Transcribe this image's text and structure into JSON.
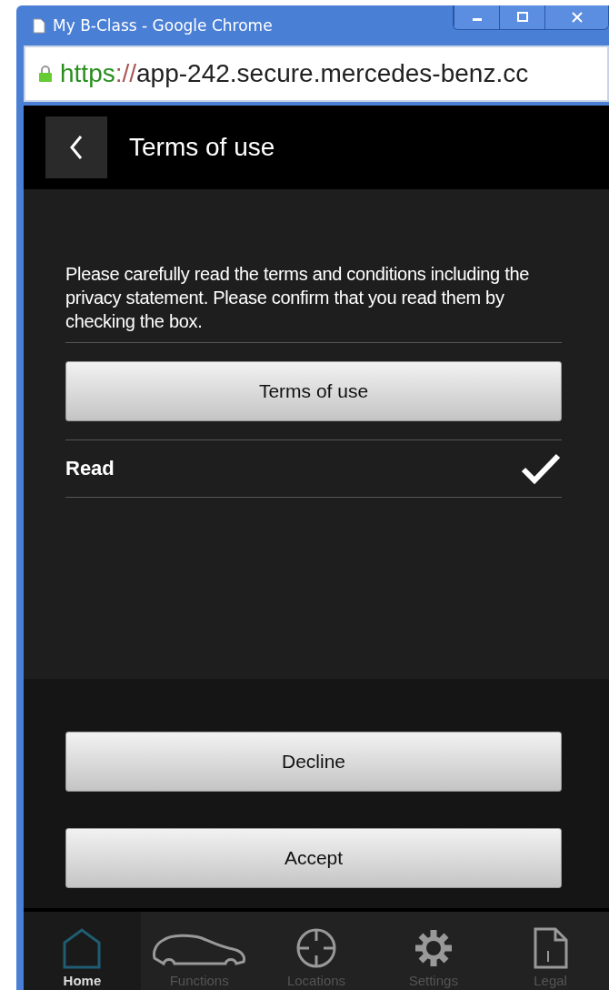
{
  "window": {
    "title": "My B-Class - Google Chrome"
  },
  "address_bar": {
    "scheme": "https",
    "separator": "://",
    "host": "app-242.secure.mercedes-benz.cc"
  },
  "header": {
    "title": "Terms of use"
  },
  "intro": "Please carefully read the terms and conditions including the privacy statement. Please confirm that you read them by checking the box.",
  "terms_button": "Terms of use",
  "read_row": {
    "label": "Read",
    "checked": true
  },
  "buttons": [
    "Decline",
    "Accept"
  ],
  "tabs": [
    {
      "label": "Home",
      "kind": "home",
      "selected": true
    },
    {
      "label": "Functions",
      "kind": "car",
      "selected": false
    },
    {
      "label": "Locations",
      "kind": "target",
      "selected": false
    },
    {
      "label": "Settings",
      "kind": "gear",
      "selected": false
    },
    {
      "label": "Legal",
      "kind": "document",
      "selected": false
    }
  ]
}
